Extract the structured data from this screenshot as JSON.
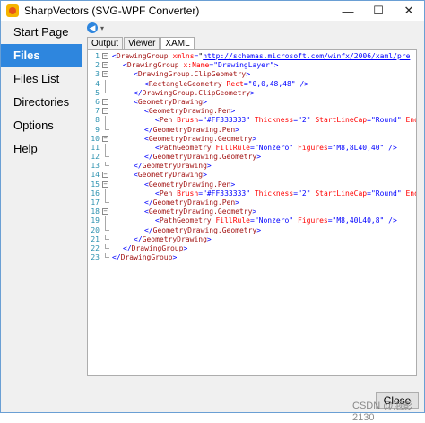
{
  "window": {
    "title": "SharpVectors (SVG-WPF Converter)",
    "minimize_glyph": "—",
    "maximize_glyph": "☐",
    "close_glyph": "✕"
  },
  "sidebar": {
    "items": [
      {
        "label": "Start Page",
        "active": false
      },
      {
        "label": "Files",
        "active": true
      },
      {
        "label": "Files List",
        "active": false
      },
      {
        "label": "Directories",
        "active": false
      },
      {
        "label": "Options",
        "active": false
      },
      {
        "label": "Help",
        "active": false
      }
    ]
  },
  "toolbar": {
    "back_glyph": "◀",
    "dropdown_glyph": "▾"
  },
  "tabs": [
    {
      "label": "Output",
      "active": false
    },
    {
      "label": "Viewer",
      "active": false
    },
    {
      "label": "XAML",
      "active": true
    }
  ],
  "editor": {
    "lines": [
      {
        "n": "1",
        "depth": 0,
        "fold": "open",
        "segments": [
          [
            "b",
            "<"
          ],
          [
            "m",
            "DrawingGroup"
          ],
          [
            "t",
            " "
          ],
          [
            "a",
            "xmlns"
          ],
          [
            "b",
            "="
          ],
          [
            "t",
            "\""
          ],
          [
            "u",
            "http://schemas.microsoft.com/winfx/2006/xaml/pre"
          ]
        ]
      },
      {
        "n": "2",
        "depth": 1,
        "fold": "open",
        "segments": [
          [
            "b",
            "<"
          ],
          [
            "m",
            "DrawingGroup"
          ],
          [
            "t",
            " "
          ],
          [
            "a",
            "x:Name"
          ],
          [
            "b",
            "="
          ],
          [
            "v",
            "\"DrawingLayer\""
          ],
          [
            "b",
            ">"
          ]
        ]
      },
      {
        "n": "3",
        "depth": 2,
        "fold": "open",
        "segments": [
          [
            "b",
            "<"
          ],
          [
            "m",
            "DrawingGroup.ClipGeometry"
          ],
          [
            "b",
            ">"
          ]
        ]
      },
      {
        "n": "4",
        "depth": 3,
        "fold": "line",
        "segments": [
          [
            "b",
            "<"
          ],
          [
            "m",
            "RectangleGeometry"
          ],
          [
            "t",
            " "
          ],
          [
            "a",
            "Rect"
          ],
          [
            "b",
            "="
          ],
          [
            "v",
            "\"0,0,48,48\""
          ],
          [
            "t",
            " "
          ],
          [
            "b",
            "/>"
          ]
        ]
      },
      {
        "n": "5",
        "depth": 2,
        "fold": "end",
        "segments": [
          [
            "b",
            "</"
          ],
          [
            "m",
            "DrawingGroup.ClipGeometry"
          ],
          [
            "b",
            ">"
          ]
        ]
      },
      {
        "n": "6",
        "depth": 2,
        "fold": "open",
        "segments": [
          [
            "b",
            "<"
          ],
          [
            "m",
            "GeometryDrawing"
          ],
          [
            "b",
            ">"
          ]
        ]
      },
      {
        "n": "7",
        "depth": 3,
        "fold": "open",
        "segments": [
          [
            "b",
            "<"
          ],
          [
            "m",
            "GeometryDrawing.Pen"
          ],
          [
            "b",
            ">"
          ]
        ]
      },
      {
        "n": "8",
        "depth": 4,
        "fold": "line",
        "segments": [
          [
            "b",
            "<"
          ],
          [
            "m",
            "Pen"
          ],
          [
            "t",
            " "
          ],
          [
            "a",
            "Brush"
          ],
          [
            "b",
            "="
          ],
          [
            "v",
            "\"#FF333333\""
          ],
          [
            "t",
            " "
          ],
          [
            "a",
            "Thickness"
          ],
          [
            "b",
            "="
          ],
          [
            "v",
            "\"2\""
          ],
          [
            "t",
            " "
          ],
          [
            "a",
            "StartLineCap"
          ],
          [
            "b",
            "="
          ],
          [
            "v",
            "\"Round\""
          ],
          [
            "t",
            " "
          ],
          [
            "a",
            "End"
          ]
        ]
      },
      {
        "n": "9",
        "depth": 3,
        "fold": "end",
        "segments": [
          [
            "b",
            "</"
          ],
          [
            "m",
            "GeometryDrawing.Pen"
          ],
          [
            "b",
            ">"
          ]
        ]
      },
      {
        "n": "10",
        "depth": 3,
        "fold": "open",
        "segments": [
          [
            "b",
            "<"
          ],
          [
            "m",
            "GeometryDrawing.Geometry"
          ],
          [
            "b",
            ">"
          ]
        ]
      },
      {
        "n": "11",
        "depth": 4,
        "fold": "line",
        "segments": [
          [
            "b",
            "<"
          ],
          [
            "m",
            "PathGeometry"
          ],
          [
            "t",
            " "
          ],
          [
            "a",
            "FillRule"
          ],
          [
            "b",
            "="
          ],
          [
            "v",
            "\"Nonzero\""
          ],
          [
            "t",
            " "
          ],
          [
            "a",
            "Figures"
          ],
          [
            "b",
            "="
          ],
          [
            "v",
            "\"M8,8L40,40\""
          ],
          [
            "t",
            " "
          ],
          [
            "b",
            "/>"
          ]
        ]
      },
      {
        "n": "12",
        "depth": 3,
        "fold": "end",
        "segments": [
          [
            "b",
            "</"
          ],
          [
            "m",
            "GeometryDrawing.Geometry"
          ],
          [
            "b",
            ">"
          ]
        ]
      },
      {
        "n": "13",
        "depth": 2,
        "fold": "end",
        "segments": [
          [
            "b",
            "</"
          ],
          [
            "m",
            "GeometryDrawing"
          ],
          [
            "b",
            ">"
          ]
        ]
      },
      {
        "n": "14",
        "depth": 2,
        "fold": "open",
        "segments": [
          [
            "b",
            "<"
          ],
          [
            "m",
            "GeometryDrawing"
          ],
          [
            "b",
            ">"
          ]
        ]
      },
      {
        "n": "15",
        "depth": 3,
        "fold": "open",
        "segments": [
          [
            "b",
            "<"
          ],
          [
            "m",
            "GeometryDrawing.Pen"
          ],
          [
            "b",
            ">"
          ]
        ]
      },
      {
        "n": "16",
        "depth": 4,
        "fold": "line",
        "segments": [
          [
            "b",
            "<"
          ],
          [
            "m",
            "Pen"
          ],
          [
            "t",
            " "
          ],
          [
            "a",
            "Brush"
          ],
          [
            "b",
            "="
          ],
          [
            "v",
            "\"#FF333333\""
          ],
          [
            "t",
            " "
          ],
          [
            "a",
            "Thickness"
          ],
          [
            "b",
            "="
          ],
          [
            "v",
            "\"2\""
          ],
          [
            "t",
            " "
          ],
          [
            "a",
            "StartLineCap"
          ],
          [
            "b",
            "="
          ],
          [
            "v",
            "\"Round\""
          ],
          [
            "t",
            " "
          ],
          [
            "a",
            "End"
          ]
        ]
      },
      {
        "n": "17",
        "depth": 3,
        "fold": "end",
        "segments": [
          [
            "b",
            "</"
          ],
          [
            "m",
            "GeometryDrawing.Pen"
          ],
          [
            "b",
            ">"
          ]
        ]
      },
      {
        "n": "18",
        "depth": 3,
        "fold": "open",
        "segments": [
          [
            "b",
            "<"
          ],
          [
            "m",
            "GeometryDrawing.Geometry"
          ],
          [
            "b",
            ">"
          ]
        ]
      },
      {
        "n": "19",
        "depth": 4,
        "fold": "line",
        "segments": [
          [
            "b",
            "<"
          ],
          [
            "m",
            "PathGeometry"
          ],
          [
            "t",
            " "
          ],
          [
            "a",
            "FillRule"
          ],
          [
            "b",
            "="
          ],
          [
            "v",
            "\"Nonzero\""
          ],
          [
            "t",
            " "
          ],
          [
            "a",
            "Figures"
          ],
          [
            "b",
            "="
          ],
          [
            "v",
            "\"M8,40L40,8\""
          ],
          [
            "t",
            " "
          ],
          [
            "b",
            "/>"
          ]
        ]
      },
      {
        "n": "20",
        "depth": 3,
        "fold": "end",
        "segments": [
          [
            "b",
            "</"
          ],
          [
            "m",
            "GeometryDrawing.Geometry"
          ],
          [
            "b",
            ">"
          ]
        ]
      },
      {
        "n": "21",
        "depth": 2,
        "fold": "end",
        "segments": [
          [
            "b",
            "</"
          ],
          [
            "m",
            "GeometryDrawing"
          ],
          [
            "b",
            ">"
          ]
        ]
      },
      {
        "n": "22",
        "depth": 1,
        "fold": "end",
        "segments": [
          [
            "b",
            "</"
          ],
          [
            "m",
            "DrawingGroup"
          ],
          [
            "b",
            ">"
          ]
        ]
      },
      {
        "n": "23",
        "depth": 0,
        "fold": "end",
        "segments": [
          [
            "b",
            "</"
          ],
          [
            "m",
            "DrawingGroup"
          ],
          [
            "b",
            ">"
          ]
        ]
      }
    ]
  },
  "footer": {
    "close_label": "Close",
    "watermark": "CSDN @泡影2130"
  }
}
